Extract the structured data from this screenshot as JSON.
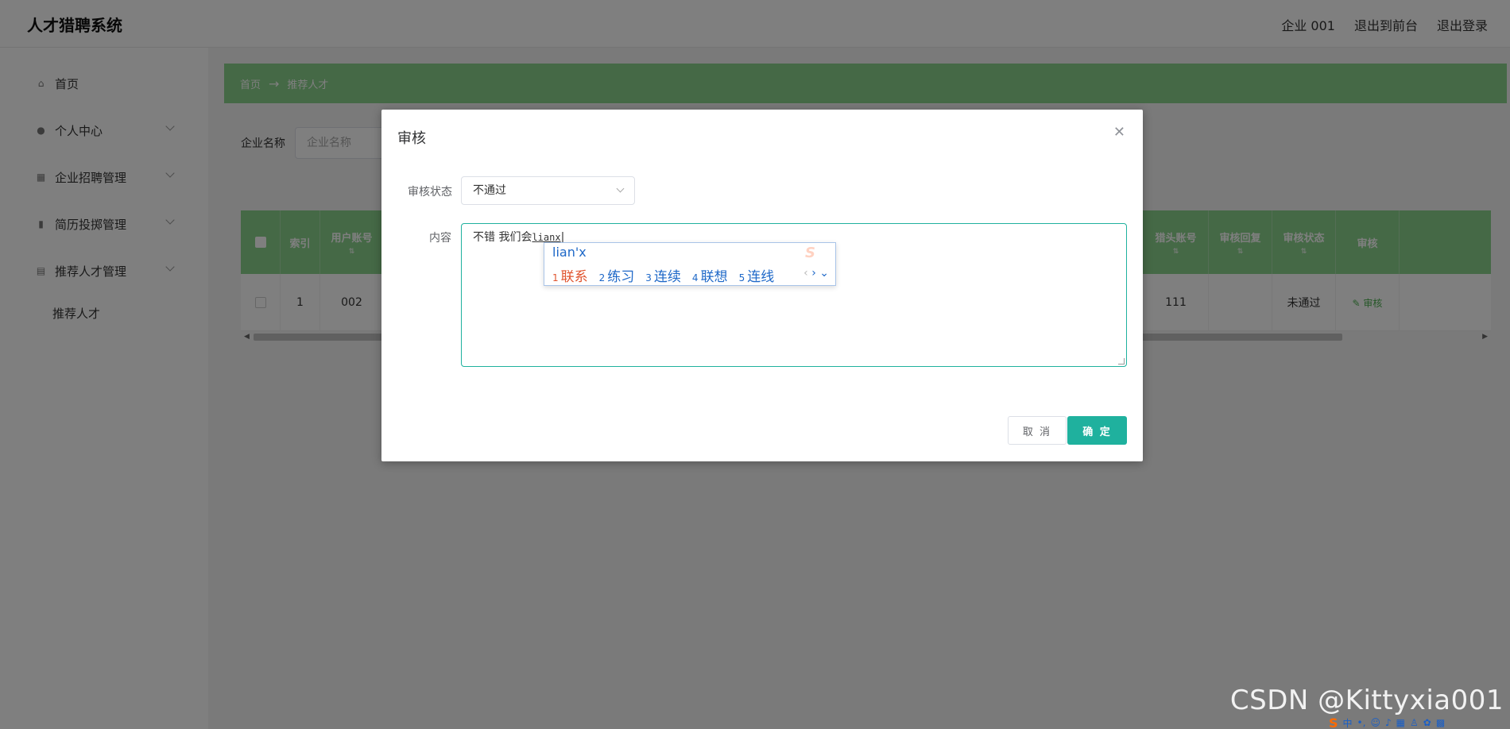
{
  "app": {
    "title": "人才猎聘系统"
  },
  "header": {
    "links": [
      "企业 001",
      "退出到前台",
      "退出登录"
    ]
  },
  "sidebar": {
    "items": [
      {
        "label": "首页",
        "icon": "home-icon"
      },
      {
        "label": "个人中心",
        "icon": "user-icon"
      },
      {
        "label": "企业招聘管理",
        "icon": "grid-icon"
      },
      {
        "label": "简历投掷管理",
        "icon": "bar-chart-icon"
      },
      {
        "label": "推荐人才管理",
        "icon": "clipboard-icon"
      }
    ],
    "sub_item": "推荐人才"
  },
  "breadcrumb": {
    "home": "首页",
    "arrow": "→",
    "current": "推荐人才"
  },
  "search": {
    "label": "企业名称",
    "placeholder": "企业名称"
  },
  "table": {
    "headers": [
      "索引",
      "用户账号",
      "猎头账号",
      "审核回复",
      "审核状态",
      "审核"
    ],
    "row": {
      "index": "1",
      "user": "002",
      "hunter": "111",
      "reply": "",
      "status": "未通过",
      "action": "审核"
    }
  },
  "dialog": {
    "title": "审核",
    "status_label": "审核状态",
    "status_value": "不通过",
    "content_label": "内容",
    "content_text": "不错  我们会",
    "content_pinyin": "lianx",
    "cancel": "取 消",
    "confirm": "确 定"
  },
  "ime": {
    "composition": "lian'x",
    "candidates": [
      {
        "num": "1",
        "text": "联系"
      },
      {
        "num": "2",
        "text": "练习"
      },
      {
        "num": "3",
        "text": "连续"
      },
      {
        "num": "4",
        "text": "联想"
      },
      {
        "num": "5",
        "text": "连线"
      }
    ]
  },
  "watermark": "CSDN @Kittyxia001",
  "colors": {
    "accent": "#1fb19e",
    "header_green": "#8bd28d",
    "ime_blue": "#1e68c8",
    "ime_selected": "#e0542e"
  }
}
